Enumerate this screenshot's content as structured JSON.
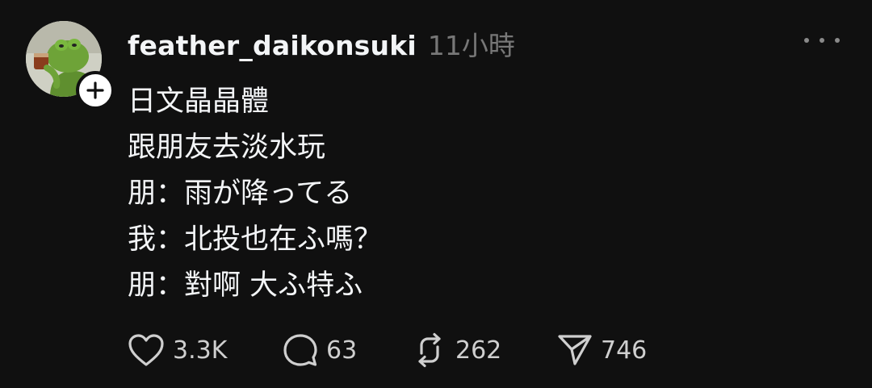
{
  "post": {
    "username": "feather_daikonsuki",
    "timestamp": "11小時",
    "lines": [
      "日文晶晶體",
      "跟朋友去淡水玩",
      "朋：雨が降ってる",
      "我：北投也在ふ嗎？",
      "朋：對啊 大ふ特ふ"
    ],
    "actions": {
      "like_count": "3.3K",
      "comment_count": "63",
      "repost_count": "262",
      "share_count": "746"
    }
  },
  "icons": {
    "avatar": "kermit-drinking-tea-avatar",
    "follow": "plus-icon",
    "more": "more-horizontal-icon",
    "like": "heart-icon",
    "comment": "comment-icon",
    "repost": "repost-icon",
    "share": "send-icon"
  },
  "colors": {
    "background": "#101010",
    "text": "#f3f5f7",
    "muted": "#777777"
  }
}
